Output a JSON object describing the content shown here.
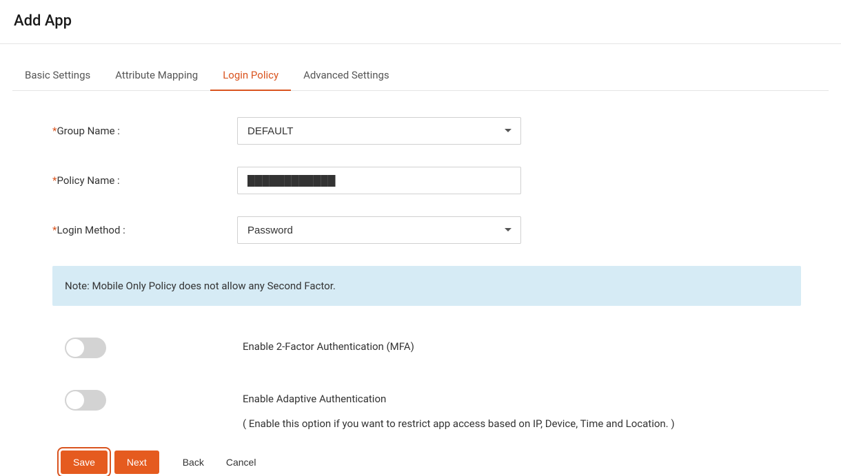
{
  "header": {
    "title": "Add App"
  },
  "tabs": [
    {
      "label": "Basic Settings",
      "active": false
    },
    {
      "label": "Attribute Mapping",
      "active": false
    },
    {
      "label": "Login Policy",
      "active": true
    },
    {
      "label": "Advanced Settings",
      "active": false
    }
  ],
  "form": {
    "group_name_label": "Group Name :",
    "group_name_value": "DEFAULT",
    "policy_name_label": "Policy Name :",
    "policy_name_value": "████████████",
    "login_method_label": "Login Method :",
    "login_method_value": "Password"
  },
  "note": "Note: Mobile Only Policy does not allow any Second Factor.",
  "toggles": {
    "mfa_label": "Enable 2-Factor Authentication (MFA)",
    "mfa_on": false,
    "adaptive_label": "Enable Adaptive Authentication",
    "adaptive_sublabel": "( Enable this option if you want to restrict app access based on IP, Device, Time and Location. )",
    "adaptive_on": false
  },
  "buttons": {
    "save": "Save",
    "next": "Next",
    "back": "Back",
    "cancel": "Cancel"
  }
}
